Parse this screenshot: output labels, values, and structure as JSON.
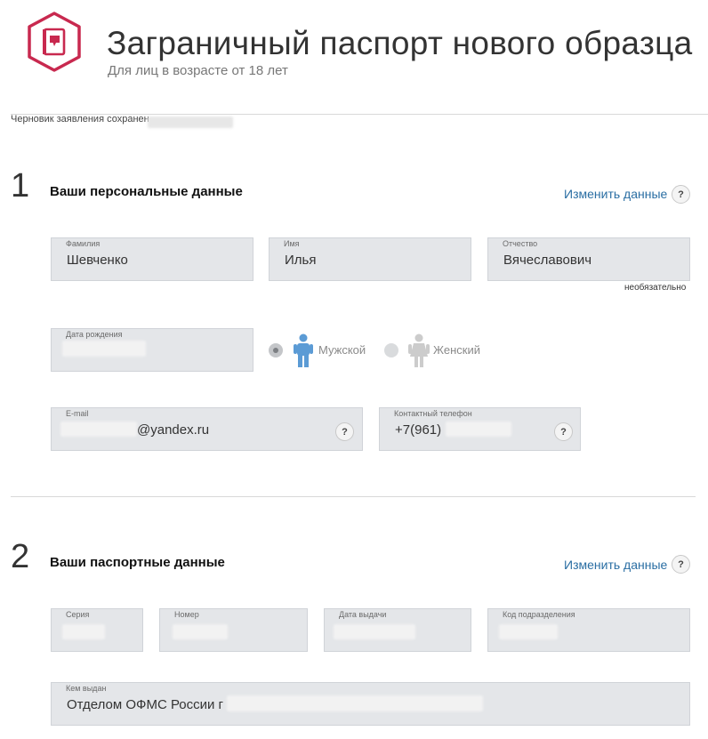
{
  "header": {
    "title": "Заграничный паспорт нового образца",
    "subtitle": "Для лиц в возрасте от 18 лет"
  },
  "draft": {
    "label": "Черновик заявления сохранен"
  },
  "section1": {
    "number": "1",
    "title": "Ваши персональные данные",
    "edit_label": "Изменить данные",
    "help": "?",
    "surname": {
      "label": "Фамилия",
      "value": "Шевченко"
    },
    "name": {
      "label": "Имя",
      "value": "Илья"
    },
    "patronymic": {
      "label": "Отчество",
      "value": "Вячеславович",
      "hint": "необязательно"
    },
    "birthdate": {
      "label": "Дата рождения"
    },
    "gender": {
      "male": "Мужской",
      "female": "Женский",
      "selected": "Мужской"
    },
    "email": {
      "label": "E-mail",
      "value_visible": "@yandex.ru",
      "help": "?"
    },
    "phone": {
      "label": "Контактный телефон",
      "value_visible": "+7(961)",
      "help": "?"
    }
  },
  "section2": {
    "number": "2",
    "title": "Ваши паспортные данные",
    "edit_label": "Изменить данные",
    "help": "?",
    "series": {
      "label": "Серия"
    },
    "number_field": {
      "label": "Номер"
    },
    "issue_date": {
      "label": "Дата выдачи"
    },
    "dept_code": {
      "label": "Код подразделения"
    },
    "issued_by": {
      "label": "Кем выдан",
      "value_visible": "Отделом ОФМС России г"
    }
  },
  "colors": {
    "accent": "#c8294f",
    "link": "#2a6ea3",
    "male_icon": "#5b9bd5",
    "female_icon": "#cccccc",
    "field_bg": "#e4e6e9"
  }
}
